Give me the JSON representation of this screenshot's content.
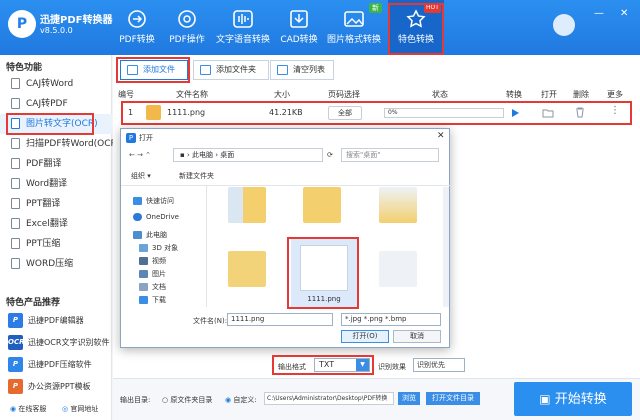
{
  "app": {
    "title": "迅捷PDF转换器",
    "version": "v8.5.0.0",
    "logo": "P"
  },
  "nav": [
    {
      "label": "PDF转换",
      "icon": "pdf-convert-icon"
    },
    {
      "label": "PDF操作",
      "icon": "pdf-operate-icon"
    },
    {
      "label": "文字语音转换",
      "icon": "voice-icon"
    },
    {
      "label": "CAD转换",
      "icon": "cad-icon"
    },
    {
      "label": "图片格式转换",
      "icon": "image-icon"
    },
    {
      "label": "特色转换",
      "icon": "feature-icon",
      "badge": "HOT",
      "new_badge": "新"
    }
  ],
  "window_controls": {
    "minimize": "—",
    "close": "✕"
  },
  "sidebar": {
    "section1": "特色功能",
    "items": [
      "CAJ转Word",
      "CAJ转PDF",
      "图片转文字(OCR)",
      "扫描PDF转Word(OCR)",
      "PDF翻译",
      "Word翻译",
      "PPT翻译",
      "Excel翻译",
      "PPT压缩",
      "WORD压缩"
    ],
    "section2": "特色产品推荐",
    "products": [
      "迅捷PDF编辑器",
      "迅捷OCR文字识别软件",
      "迅捷PDF压缩软件",
      "办公资源PPT模板"
    ],
    "online": "在线客服",
    "website": "官网地址"
  },
  "toolbar": {
    "add_file": "添加文件",
    "add_folder": "添加文件夹",
    "clear_list": "清空列表"
  },
  "table": {
    "headers": [
      "编号",
      "文件名称",
      "大小",
      "页码选择",
      "状态",
      "转换",
      "打开",
      "删除",
      "更多"
    ],
    "row": {
      "index": "1",
      "name": "1111.png",
      "size": "41.21KB",
      "pages": "全部",
      "progress": "0%",
      "progress_value": 0
    }
  },
  "dialog": {
    "title": "打开",
    "path": [
      "此电脑",
      "桌面"
    ],
    "search_placeholder": "搜索\"桌面\"",
    "organize": "组织 ▾",
    "new_folder": "新建文件夹",
    "tree": [
      "快速访问",
      "OneDrive",
      "此电脑",
      "3D 对象",
      "视频",
      "图片",
      "文档",
      "下载"
    ],
    "selected_file": "1111.png",
    "filename_label": "文件名(N):",
    "filename_value": "1111.png",
    "filetype": "*.jpg *.png *.bmp",
    "open": "打开(O)",
    "cancel": "取消"
  },
  "options": {
    "format_label": "输出格式",
    "format_value": "TXT",
    "effect_label": "识别效果",
    "effect_value": "识别优先"
  },
  "bottom": {
    "output_label": "输出目录:",
    "radio_source": "原文件夹目录",
    "radio_custom": "自定义:",
    "path": "C:\\Users\\Administrator\\Desktop\\PDF转换",
    "browse": "浏览",
    "open_folder": "打开文件目录",
    "start": "开始转换"
  }
}
